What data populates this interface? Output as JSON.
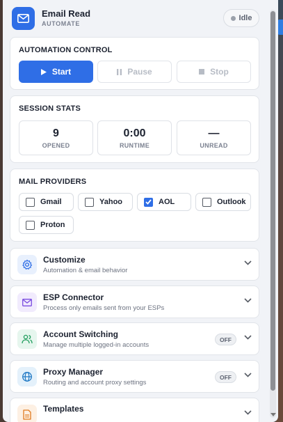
{
  "app": {
    "title": "Email Read",
    "subtitle": "AUTOMATE",
    "status": "Idle"
  },
  "control": {
    "heading": "AUTOMATION CONTROL",
    "start_label": "Start",
    "pause_label": "Pause",
    "stop_label": "Stop"
  },
  "stats": {
    "heading": "SESSION STATS",
    "items": [
      {
        "value": "9",
        "label": "OPENED"
      },
      {
        "value": "0:00",
        "label": "RUNTIME"
      },
      {
        "value": "—",
        "label": "UNREAD"
      }
    ]
  },
  "providers": {
    "heading": "MAIL PROVIDERS",
    "items": [
      {
        "label": "Gmail",
        "checked": false
      },
      {
        "label": "Yahoo",
        "checked": false
      },
      {
        "label": "AOL",
        "checked": true
      },
      {
        "label": "Outlook",
        "checked": false
      },
      {
        "label": "Proton",
        "checked": false
      }
    ]
  },
  "features": [
    {
      "title": "Customize",
      "desc": "Automation & email behavior",
      "icon": "gear-icon",
      "toggle": ""
    },
    {
      "title": "ESP Connector",
      "desc": "Process only emails sent from your ESPs",
      "icon": "mail-icon",
      "toggle": ""
    },
    {
      "title": "Account Switching",
      "desc": "Manage multiple logged-in accounts",
      "icon": "users-icon",
      "toggle": "OFF"
    },
    {
      "title": "Proxy Manager",
      "desc": "Routing and account proxy settings",
      "icon": "globe-icon",
      "toggle": "OFF"
    },
    {
      "title": "Templates",
      "desc": "",
      "icon": "document-icon",
      "toggle": ""
    }
  ],
  "colors": {
    "accent": "#2f6ee6",
    "background": "#f1f3f7",
    "card": "#ffffff"
  }
}
